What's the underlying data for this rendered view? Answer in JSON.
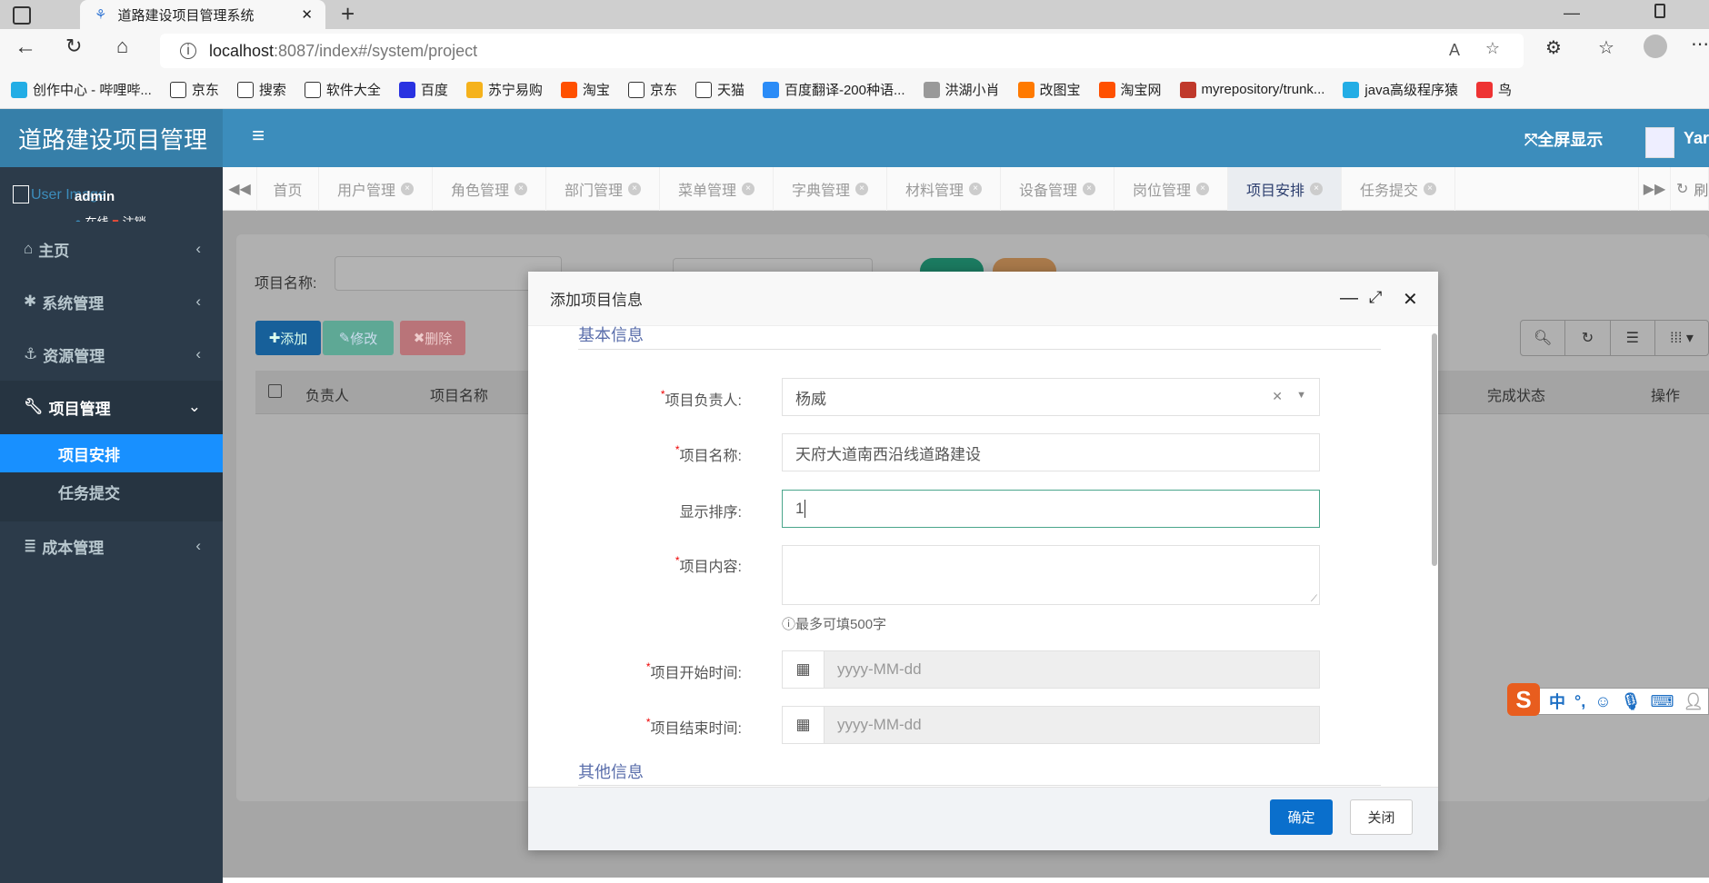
{
  "browser": {
    "tab_title": "道路建设项目管理系统",
    "url_host": "localhost",
    "url_rest": ":8087/index#/system/project",
    "bookmarks": [
      {
        "label": "创作中心 - 哔哩哔...",
        "color": "#23ade5"
      },
      {
        "label": "京东",
        "color": "#fff"
      },
      {
        "label": "搜索",
        "color": "#fff"
      },
      {
        "label": "软件大全",
        "color": "#fff"
      },
      {
        "label": "百度",
        "color": "#2932e1"
      },
      {
        "label": "苏宁易购",
        "color": "#f5b21c"
      },
      {
        "label": "淘宝",
        "color": "#ff5000"
      },
      {
        "label": "京东",
        "color": "#fff"
      },
      {
        "label": "天猫",
        "color": "#fff"
      },
      {
        "label": "百度翻译-200种语...",
        "color": "#2b8cf7"
      },
      {
        "label": "洪湖小肖",
        "color": "#999"
      },
      {
        "label": "改图宝",
        "color": "#ff7a00"
      },
      {
        "label": "淘宝网",
        "color": "#ff5000"
      },
      {
        "label": "myrepository/trunk...",
        "color": "#c0392b"
      },
      {
        "label": "java高级程序猿",
        "color": "#23ade5"
      },
      {
        "label": "鸟",
        "color": "#e33"
      }
    ]
  },
  "app": {
    "logo": "道路建设项目管理",
    "fullscreen": "全屏显示",
    "user_short": "Yar",
    "user_image_alt": "User Image",
    "username": "admin",
    "online": "在线",
    "logout": "注销"
  },
  "sidebar": {
    "items": [
      {
        "label": "主页",
        "icon": "home-icon"
      },
      {
        "label": "系统管理",
        "icon": "gear-icon"
      },
      {
        "label": "资源管理",
        "icon": "anchor-icon"
      },
      {
        "label": "项目管理",
        "icon": "wrench-icon"
      },
      {
        "label": "成本管理",
        "icon": "database-icon"
      }
    ],
    "sub": [
      {
        "label": "项目安排",
        "active": true
      },
      {
        "label": "任务提交",
        "active": false
      }
    ]
  },
  "tabs": {
    "items": [
      "首页",
      "用户管理",
      "角色管理",
      "部门管理",
      "菜单管理",
      "字典管理",
      "材料管理",
      "设备管理",
      "岗位管理",
      "项目安排",
      "任务提交"
    ],
    "active": "项目安排",
    "refresh": "刷"
  },
  "page": {
    "search_label": "项目名称:",
    "add": "添加",
    "edit": "修改",
    "delete": "删除",
    "columns": [
      "负责人",
      "项目名称",
      "完成状态",
      "操作"
    ]
  },
  "modal": {
    "title": "添加项目信息",
    "section_basic": "基本信息",
    "section_other": "其他信息",
    "fields": {
      "leader": {
        "label": "项目负责人:",
        "value": "杨威",
        "required": true
      },
      "name": {
        "label": "项目名称:",
        "value": "天府大道南西沿线道路建设",
        "required": true
      },
      "order": {
        "label": "显示排序:",
        "value": "1",
        "required": false
      },
      "content": {
        "label": "项目内容:",
        "value": "",
        "required": true
      },
      "content_help": "最多可填500字",
      "start": {
        "label": "项目开始时间:",
        "placeholder": "yyyy-MM-dd",
        "required": true
      },
      "end": {
        "label": "项目结束时间:",
        "placeholder": "yyyy-MM-dd",
        "required": true
      }
    },
    "confirm": "确定",
    "close": "关闭"
  },
  "ime": {
    "lang": "中",
    "punct": "°,"
  },
  "colors": {
    "header": "#3c8dbc",
    "logo": "#367fa9",
    "sidebar": "#2c3b4a",
    "active_menu": "#1890ff",
    "primary": "#0a6fcc"
  }
}
